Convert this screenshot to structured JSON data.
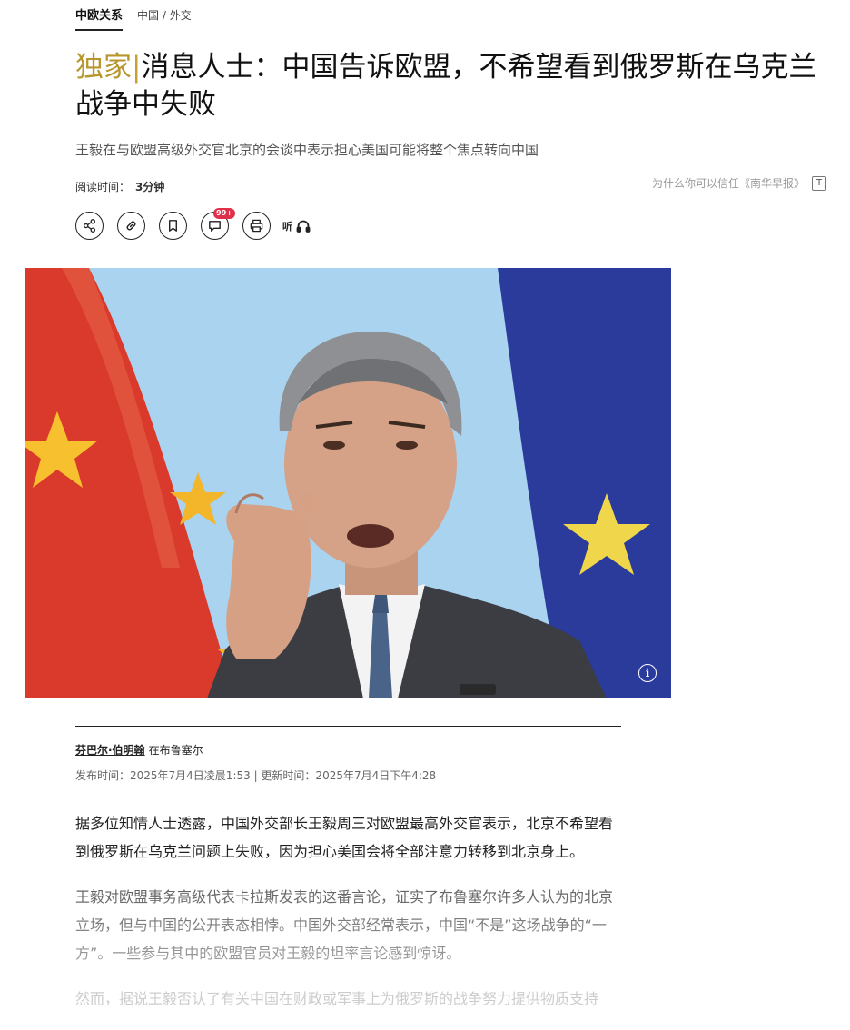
{
  "category": {
    "main": "中欧关系",
    "sub": "中国 / 外交"
  },
  "headline": {
    "tag": "独家",
    "separator": "|",
    "text": "消息人士：中国告诉欧盟，不希望看到俄罗斯在乌克兰战争中失败"
  },
  "subtitle": "王毅在与欧盟高级外交官北京的会谈中表示担心美国可能将整个焦点转向中国",
  "reading": {
    "label": "阅读时间：",
    "value": "3分钟"
  },
  "trust_link": "为什么你可以信任《南华早报》",
  "toolbar": {
    "comment_badge": "99+",
    "listen_label": "听"
  },
  "byline": {
    "author": "芬巴尔·伯明翰",
    "location": "在布鲁塞尔"
  },
  "published": "发布时间：2025年7月4日凌晨1:53 | 更新时间：2025年7月4日下午4:28",
  "article": {
    "p1": "据多位知情人士透露，中国外交部长王毅周三对欧盟最高外交官表示，北京不希望看到俄罗斯在乌克兰问题上失败，因为担心美国会将全部注意力转移到北京身上。",
    "p2": "王毅对欧盟事务高级代表卡拉斯发表的这番言论，证实了布鲁塞尔许多人认为的北京立场，但与中国的公开表态相悖。中国外交部经常表示，中国“不是”这场战争的“一方”。一些参与其中的欧盟官员对王毅的坦率言论感到惊讶。",
    "p3": "然而，据说王毅否认了有关中国在财政或军事上为俄罗斯的战争努力提供物质支持"
  },
  "colors": {
    "accent": "#b8962e",
    "badge": "#e0314b",
    "sky": "#a9d3ef"
  }
}
